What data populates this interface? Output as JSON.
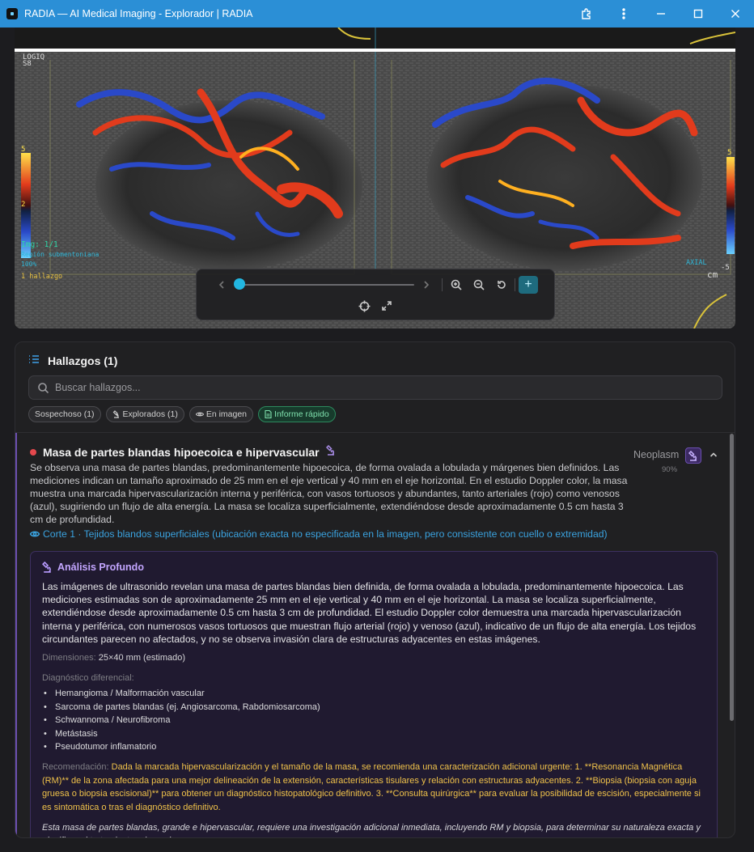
{
  "window": {
    "title": "RADIA — AI Medical Imaging - Explorador | RADIA",
    "controls": [
      "extension-icon",
      "more-icon",
      "minimize-icon",
      "maximize-icon",
      "close-icon"
    ]
  },
  "viewer": {
    "overlay": {
      "img_counter": "Img: 1/1",
      "region": "Región submentoniana",
      "zoom": "100%",
      "finding_label": "1 hallazgo",
      "orientation": "AXIAL",
      "scale_unit": "cm",
      "top_left_label": "LOGIQ",
      "top_left_sub": "S8",
      "colorbar_top": "5",
      "colorbar_mid": "2",
      "colorbar_right_top": "5",
      "colorbar_right_bottom": "-5"
    },
    "slider": {
      "value": 0.0
    },
    "colors": {
      "accent": "#22b6e0",
      "doppler_red": "#e23b1c",
      "doppler_blue": "#2a49c9"
    }
  },
  "findings_panel": {
    "title": "Hallazgos (1)",
    "search_placeholder": "Buscar hallazgos...",
    "chips": [
      {
        "label": "Sospechoso (1)"
      },
      {
        "label": "Explorados (1)"
      },
      {
        "label": "En imagen"
      },
      {
        "label": "Informe rápido"
      }
    ],
    "finding": {
      "title": "Masa de partes blandas hipoecoica e hipervascular",
      "classification": "Neoplasm",
      "confidence": "90%",
      "severity_color": "#e5484d",
      "description": "Se observa una masa de partes blandas, predominantemente hipoecoica, de forma ovalada a lobulada y márgenes bien definidos. Las mediciones indican un tamaño aproximado de 25 mm en el eje vertical y 40 mm en el eje horizontal. En el estudio Doppler color, la masa muestra una marcada hipervascularización interna y periférica, con vasos tortuosos y abundantes, tanto arteriales (rojo) como venosos (azul), sugiriendo un flujo de alta energía. La masa se localiza superficialmente, extendiéndose desde aproximadamente 0.5 cm hasta 3 cm de profundidad.",
      "location": "Corte 1 · Tejidos blandos superficiales (ubicación exacta no especificada en la imagen, pero consistente con cuello o extremidad)",
      "analysis": {
        "title": "Análisis Profundo",
        "text": "Las imágenes de ultrasonido revelan una masa de partes blandas bien definida, de forma ovalada a lobulada, predominantemente hipoecoica. Las mediciones estimadas son de aproximadamente 25 mm en el eje vertical y 40 mm en el eje horizontal. La masa se localiza superficialmente, extendiéndose desde aproximadamente 0.5 cm hasta 3 cm de profundidad. El estudio Doppler color demuestra una marcada hipervascularización interna y periférica, con numerosos vasos tortuosos que muestran flujo arterial (rojo) y venoso (azul), indicativo de un flujo de alta energía. Los tejidos circundantes parecen no afectados, y no se observa invasión clara de estructuras adyacentes en estas imágenes.",
        "dimensions_label": "Dimensiones:",
        "dimensions_value": "25×40 mm (estimado)",
        "ddx_label": "Diagnóstico diferencial:",
        "ddx": [
          "Hemangioma / Malformación vascular",
          "Sarcoma de partes blandas (ej. Angiosarcoma, Rabdomiosarcoma)",
          "Schwannoma / Neurofibroma",
          "Metástasis",
          "Pseudotumor inflamatorio"
        ],
        "recommendation_label": "Recomendación:",
        "recommendation": "Dada la marcada hipervascularización y el tamaño de la masa, se recomienda una caracterización adicional urgente: 1. **Resonancia Magnética (RM)** de la zona afectada para una mejor delineación de la extensión, características tisulares y relación con estructuras adyacentes. 2. **Biopsia (biopsia con aguja gruesa o biopsia escisional)** para obtener un diagnóstico histopatológico definitivo. 3. **Consulta quirúrgica** para evaluar la posibilidad de escisión, especialmente si es sintomática o tras el diagnóstico definitivo.",
        "summary": "Esta masa de partes blandas, grande e hipervascular, requiere una investigación adicional inmediata, incluyendo RM y biopsia, para determinar su naturaleza exacta y planificar el tratamiento adecuado."
      }
    }
  }
}
